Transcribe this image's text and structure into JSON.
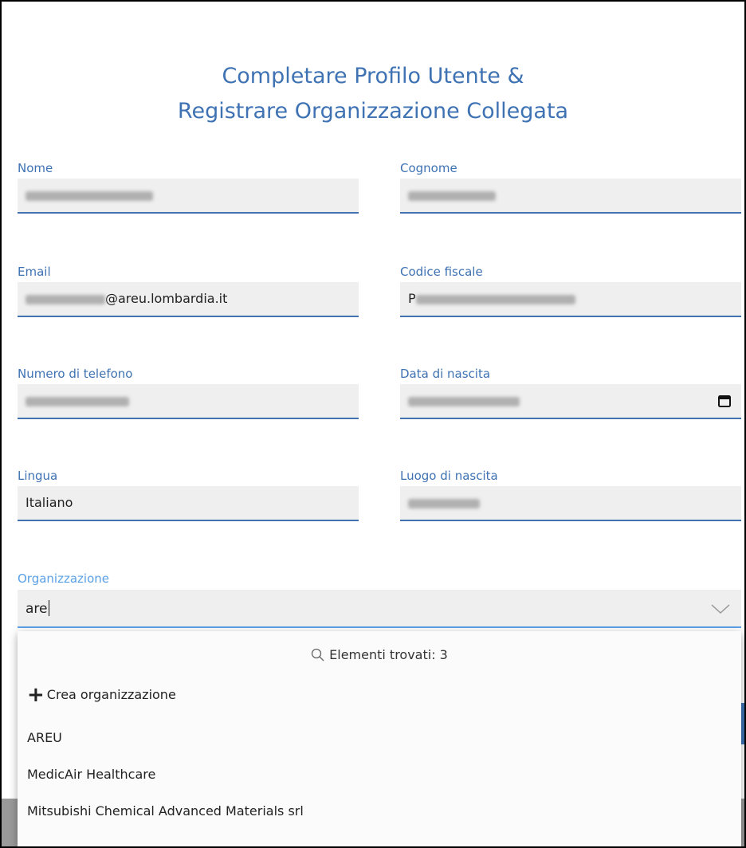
{
  "title": {
    "line1": "Completare Profilo Utente &",
    "line2": "Registrare Organizzazione Collegata"
  },
  "fields": {
    "nome": {
      "label": "Nome"
    },
    "cognome": {
      "label": "Cognome"
    },
    "email": {
      "label": "Email",
      "value_visible": "@areu.lombardia.it"
    },
    "codice_fiscale": {
      "label": "Codice fiscale",
      "value_visible": "P"
    },
    "telefono": {
      "label": "Numero di telefono"
    },
    "data_nascita": {
      "label": "Data di nascita"
    },
    "lingua": {
      "label": "Lingua",
      "value": "Italiano"
    },
    "luogo_nascita": {
      "label": "Luogo di nascita"
    }
  },
  "organizzazione": {
    "label": "Organizzazione",
    "input_value": "are",
    "found_text": "Elementi trovati: 3",
    "create_label": "Crea organizzazione",
    "options": [
      "AREU",
      "MedicAir Healthcare",
      "Mitsubishi Chemical Advanced Materials srl"
    ]
  },
  "colors": {
    "accent": "#3e72b3",
    "focus": "#5aa0e6",
    "field_bg": "#efefef"
  },
  "icons": {
    "calendar": "calendar-icon",
    "chevron": "chevron-down-icon",
    "search": "search-icon",
    "plus": "plus-icon"
  }
}
